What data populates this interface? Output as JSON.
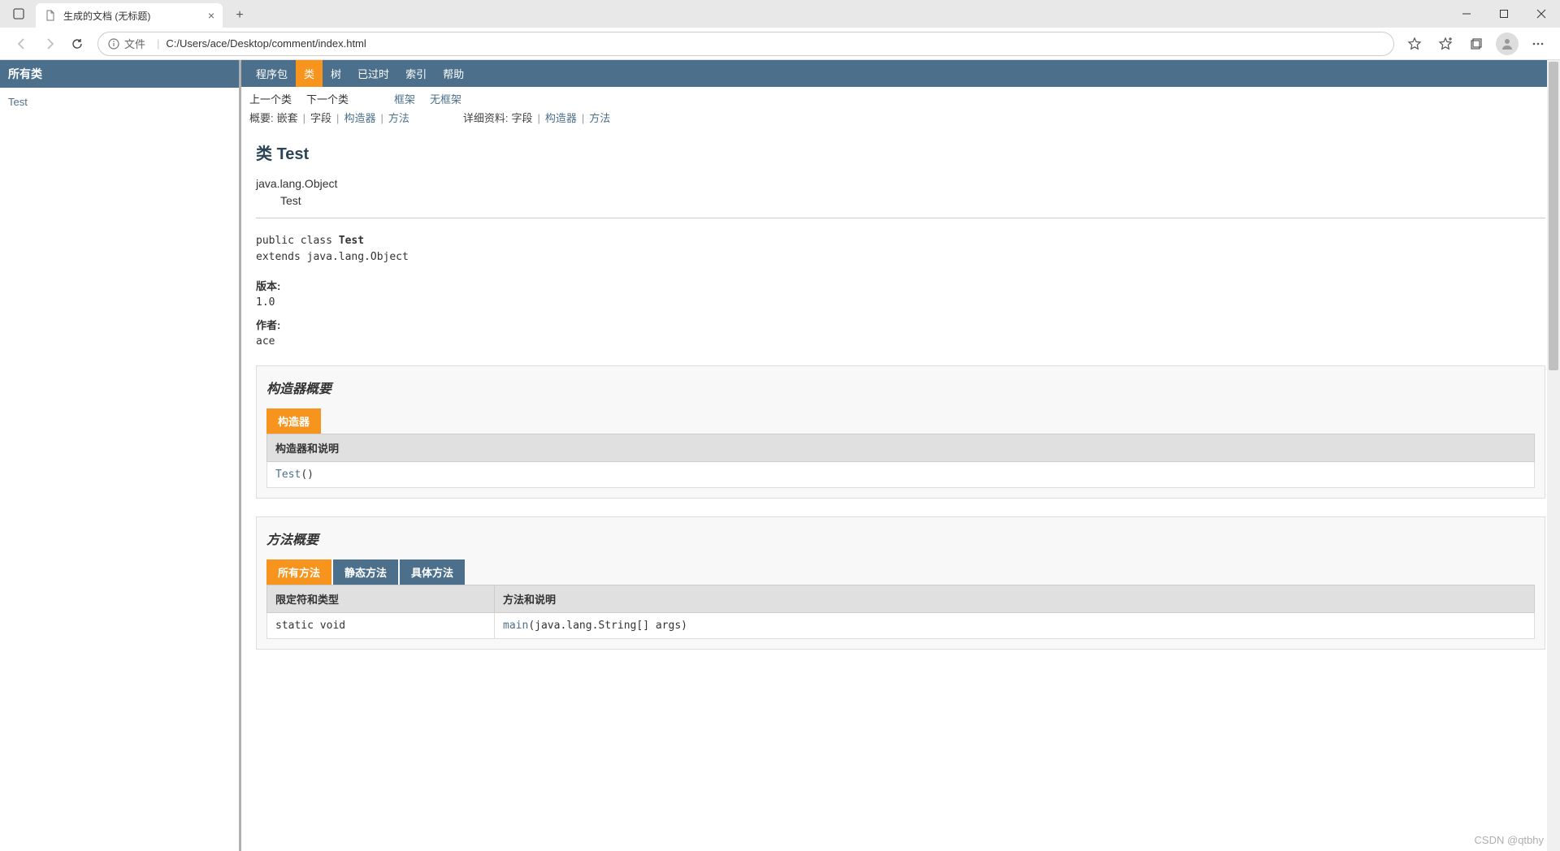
{
  "browser": {
    "tab_title": "生成的文档 (无标题)",
    "url_label": "文件",
    "url": "C:/Users/ace/Desktop/comment/index.html"
  },
  "sidebar": {
    "header": "所有类",
    "items": [
      "Test"
    ]
  },
  "topnav": {
    "items": [
      "程序包",
      "类",
      "树",
      "已过时",
      "索引",
      "帮助"
    ],
    "active_index": 1
  },
  "subnav": {
    "prev": "上一个类",
    "next": "下一个类",
    "frames": "框架",
    "noframes": "无框架",
    "summary_label": "概要:",
    "summary_nested": "嵌套",
    "summary_field": "字段",
    "summary_constr": "构造器",
    "summary_method": "方法",
    "detail_label": "详细资料:",
    "detail_field": "字段",
    "detail_constr": "构造器",
    "detail_method": "方法"
  },
  "class": {
    "heading_pre": "类 ",
    "heading_name": "Test",
    "inheritance_parent": "java.lang.Object",
    "inheritance_self": "Test",
    "sig_line1_pre": "public class ",
    "sig_line1_cls": "Test",
    "sig_line2": "extends java.lang.Object",
    "version_label": "版本:",
    "version_value": "1.0",
    "author_label": "作者:",
    "author_value": "ace"
  },
  "constructor": {
    "section_title": "构造器概要",
    "tab_label": "构造器",
    "col_header": "构造器和说明",
    "name": "Test",
    "parens": "()"
  },
  "method": {
    "section_title": "方法概要",
    "tabs": [
      "所有方法",
      "静态方法",
      "具体方法"
    ],
    "col1": "限定符和类型",
    "col2": "方法和说明",
    "row": {
      "modifier": "static void",
      "name": "main",
      "args": "(java.lang.String[]  args)"
    }
  },
  "watermark": "CSDN @qtbhy"
}
